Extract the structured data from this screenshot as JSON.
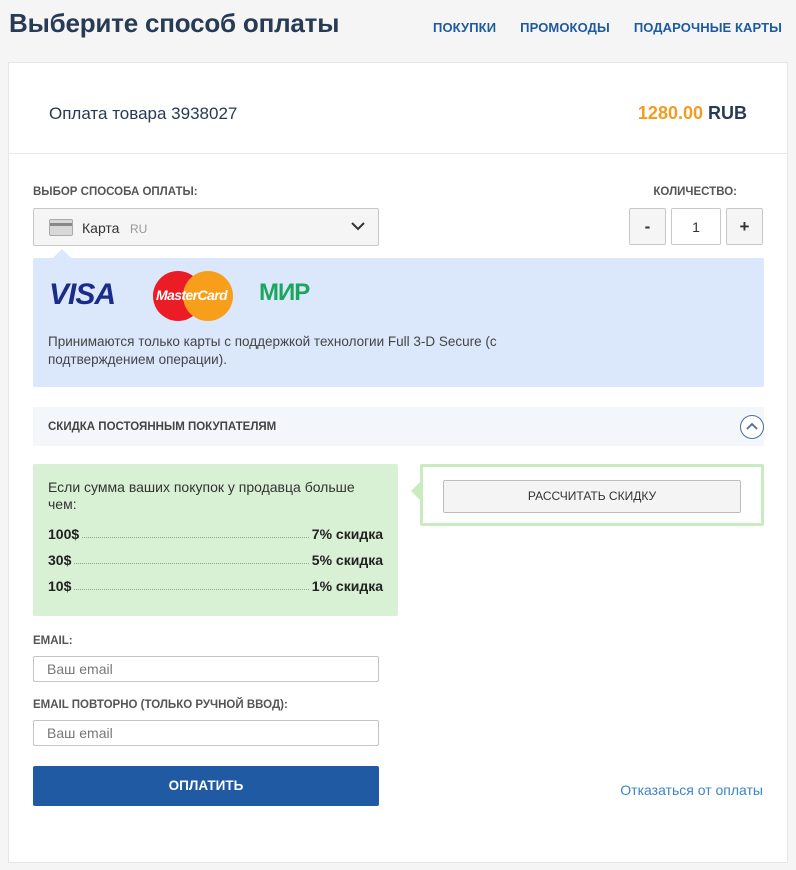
{
  "page": {
    "title": "Выберите способ оплаты"
  },
  "nav": {
    "items": [
      {
        "label": "ПОКУПКИ"
      },
      {
        "label": "ПРОМОКОДЫ"
      },
      {
        "label": "ПОДАРОЧНЫЕ КАРТЫ"
      }
    ]
  },
  "order": {
    "title": "Оплата товара 3938027",
    "amount": "1280.00",
    "currency": "RUB"
  },
  "payment_method": {
    "label": "ВЫБОР СПОСОБА ОПЛАТЫ:",
    "selected": "Карта",
    "region": "RU",
    "icon": "credit-card-icon"
  },
  "quantity": {
    "label": "КОЛИЧЕСТВО:",
    "minus": "-",
    "plus": "+",
    "value": "1"
  },
  "card_info": {
    "logos": {
      "visa": "VISA",
      "mastercard": "MasterCard",
      "mir": "МИР"
    },
    "text": "Принимаются только карты с поддержкой технологии Full 3-D Secure (с подтверждением операции)."
  },
  "discount": {
    "title": "СКИДКА ПОСТОЯННЫМ ПОКУПАТЕЛЯМ",
    "intro": "Если сумма ваших покупок у продавца больше чем:",
    "rows": [
      {
        "threshold": "100$",
        "discount": "7% скидка"
      },
      {
        "threshold": "30$",
        "discount": "5% скидка"
      },
      {
        "threshold": "10$",
        "discount": "1% скидка"
      }
    ],
    "calc_button": "РАССЧИТАТЬ СКИДКУ"
  },
  "email": {
    "label": "EMAIL:",
    "placeholder": "Ваш email",
    "value": ""
  },
  "email_repeat": {
    "label": "EMAIL ПОВТОРНО (ТОЛЬКО РУЧНОЙ ВВОД):",
    "placeholder": "Ваш email",
    "value": ""
  },
  "actions": {
    "pay": "ОПЛАТИТЬ",
    "cancel": "Отказаться от оплаты"
  },
  "colors": {
    "title": "#273b55",
    "nav": "#1e5aa0",
    "price": "#f39c1f",
    "primary": "#1f5aa3",
    "info_bg": "#dbe8fb",
    "discount_bg": "#d8f0d3",
    "link": "#3a85c8"
  }
}
